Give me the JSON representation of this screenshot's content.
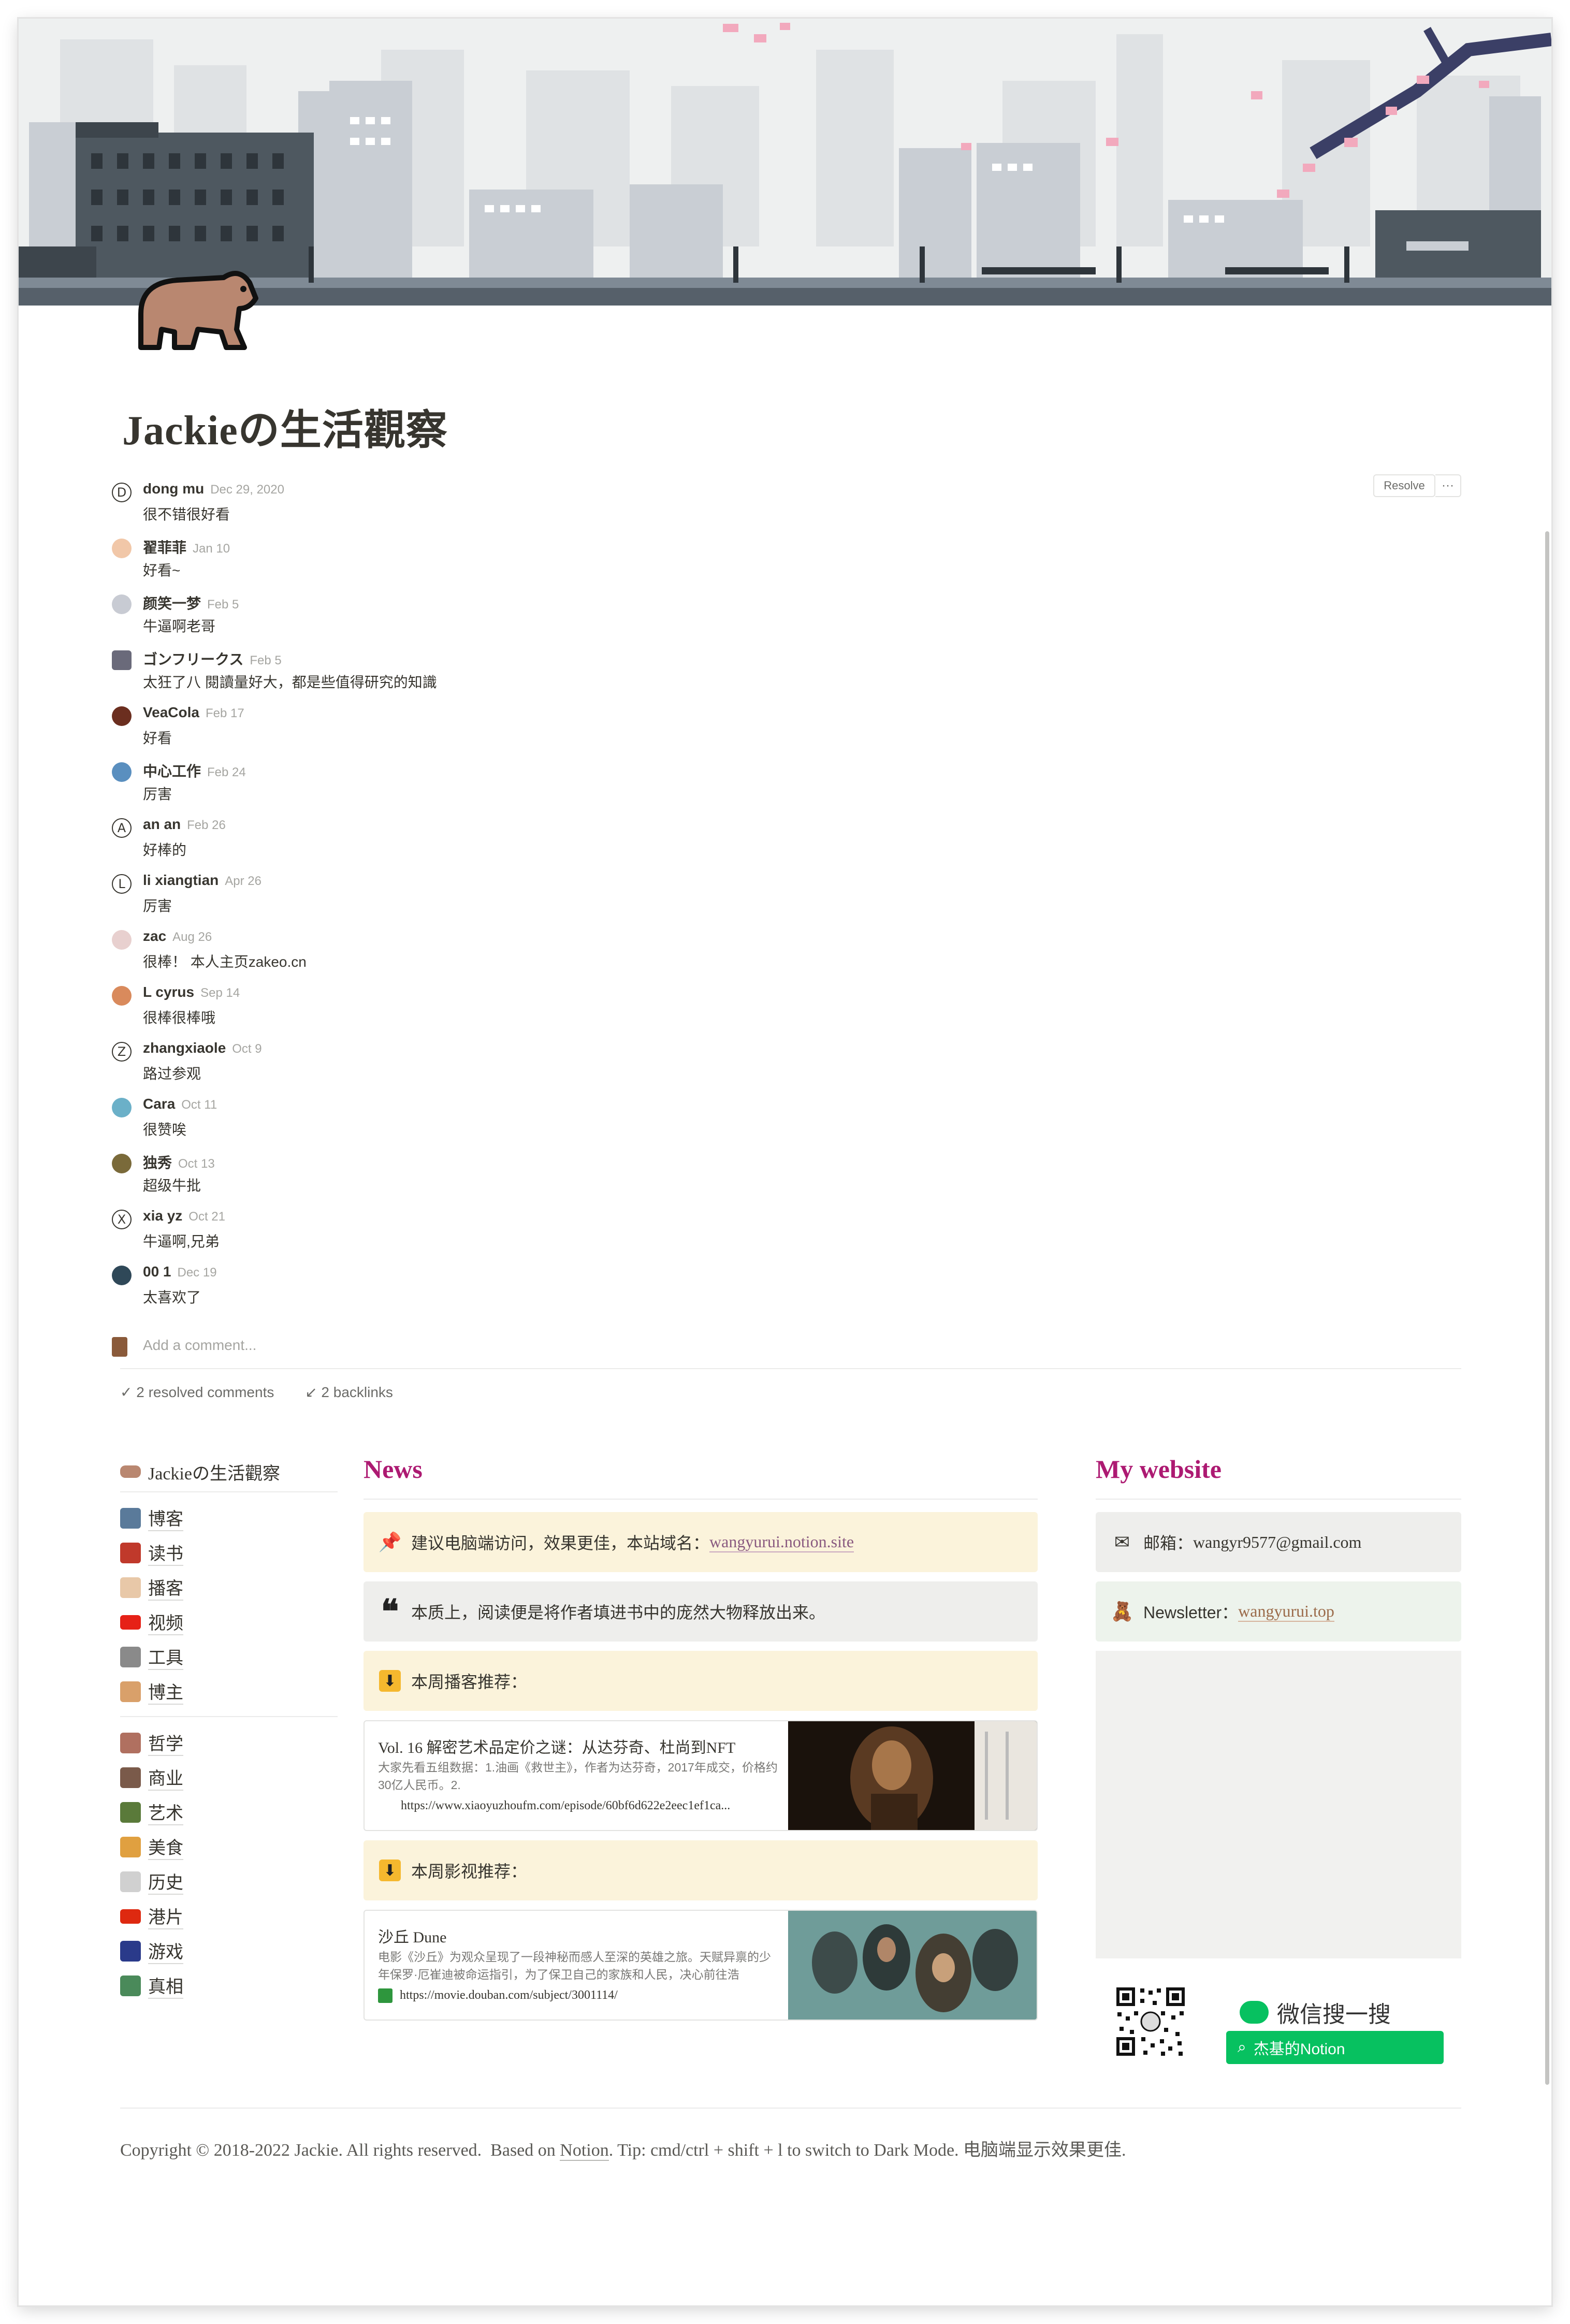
{
  "page": {
    "title": "Jackieの生活觀察"
  },
  "comments": [
    {
      "name": "dong mu",
      "date": "Dec 29, 2020",
      "text": "很不错很好看",
      "avatar": "D"
    },
    {
      "name": "翟菲菲",
      "date": "Jan 10",
      "text": "好看~",
      "avatar": ""
    },
    {
      "name": "颜笑一梦",
      "date": "Feb 5",
      "text": "牛逼啊老哥",
      "avatar": ""
    },
    {
      "name": "ゴンフリークス",
      "date": "Feb 5",
      "text": "太狂了八 閱讀量好大，都是些值得研究的知識",
      "avatar": ""
    },
    {
      "name": "VeaCola",
      "date": "Feb 17",
      "text": "好看",
      "avatar": ""
    },
    {
      "name": "中心工作",
      "date": "Feb 24",
      "text": "厉害",
      "avatar": ""
    },
    {
      "name": "an an",
      "date": "Feb 26",
      "text": "好棒的",
      "avatar": "A"
    },
    {
      "name": "li xiangtian",
      "date": "Apr 26",
      "text": "厉害",
      "avatar": "L"
    },
    {
      "name": "zac",
      "date": "Aug 26",
      "text": "很棒！ 本人主页zakeo.cn",
      "avatar": ""
    },
    {
      "name": "L cyrus",
      "date": "Sep 14",
      "text": "很棒很棒哦",
      "avatar": ""
    },
    {
      "name": "zhangxiaole",
      "date": "Oct 9",
      "text": "路过参观",
      "avatar": "Z"
    },
    {
      "name": "Cara",
      "date": "Oct 11",
      "text": "很赞唉",
      "avatar": ""
    },
    {
      "name": "独秀",
      "date": "Oct 13",
      "text": "超级牛批",
      "avatar": ""
    },
    {
      "name": "xia yz",
      "date": "Oct 21",
      "text": "牛逼啊,兄弟",
      "avatar": "X"
    },
    {
      "name": "00 1",
      "date": "Dec 19",
      "text": "太喜欢了",
      "avatar": ""
    }
  ],
  "comment_actions": {
    "resolve": "Resolve",
    "more": "···",
    "add_placeholder": "Add a comment..."
  },
  "meta": {
    "resolved": "2 resolved comments",
    "backlinks": "2 backlinks"
  },
  "sidebar": {
    "title": "Jackieの生活觀察",
    "group1": [
      {
        "label": "博客"
      },
      {
        "label": "读书"
      },
      {
        "label": "播客"
      },
      {
        "label": "视频"
      },
      {
        "label": "工具"
      },
      {
        "label": "博主"
      }
    ],
    "group2": [
      {
        "label": "哲学"
      },
      {
        "label": "商业"
      },
      {
        "label": "艺术"
      },
      {
        "label": "美食"
      },
      {
        "label": "历史"
      },
      {
        "label": "港片"
      },
      {
        "label": "游戏"
      },
      {
        "label": "真相"
      }
    ]
  },
  "news": {
    "heading": "News",
    "notice_prefix": "建议电脑端访问，效果更佳，本站域名：",
    "notice_link": "wangyurui.notion.site",
    "quote": "本质上，阅读便是将作者填进书中的庞然大物释放出来。",
    "podcast_heading": "本周播客推荐：",
    "podcast": {
      "title": "Vol. 16 解密艺术品定价之谜：从达芬奇、杜尚到NFT",
      "desc": "大家先看五组数据：1.油画《救世主》，作者为达芬奇，2017年成交，价格约30亿人民币。2.",
      "url": "https://www.xiaoyuzhoufm.com/episode/60bf6d622e2eec1ef1ca..."
    },
    "movie_heading": "本周影视推荐：",
    "movie": {
      "title": "沙丘 Dune",
      "desc": "电影《沙丘》为观众呈现了一段神秘而感人至深的英雄之旅。天赋异禀的少年保罗·厄崔迪被命运指引，为了保卫自己的家族和人民，决心前往浩",
      "url": "https://movie.douban.com/subject/3001114/"
    }
  },
  "website": {
    "heading": "My website",
    "email_label": "邮箱：",
    "email": "wangyr9577@gmail.com",
    "newsletter_label": "Newsletter：",
    "newsletter_link": "wangyurui.top",
    "wechat_title": "微信搜一搜",
    "wechat_search": "杰基的Notion"
  },
  "footer": {
    "copyright": "Copyright © 2018-2022 Jackie. All rights reserved.",
    "based_on": "Based on",
    "notion": "Notion",
    "tip": ".   Tip: cmd/ctrl + shift + l to switch to Dark Mode. 电脑端显示效果更佳."
  },
  "colors": {
    "accent": "#ad1a72",
    "wechat_green": "#07c160"
  }
}
